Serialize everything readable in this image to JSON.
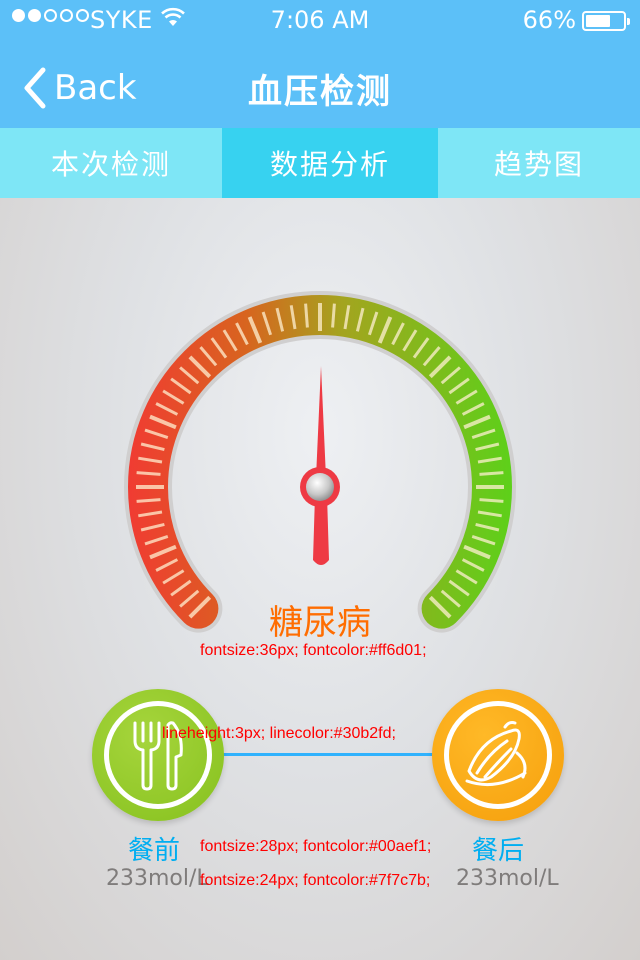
{
  "status_bar": {
    "carrier": "SYKE",
    "time": "7:06 AM",
    "battery": "66%",
    "signal_bars": 2,
    "battery_level": 0.66
  },
  "nav": {
    "back_label": "Back",
    "title": "血压检测"
  },
  "tabs": [
    {
      "label": "本次检测",
      "active": false
    },
    {
      "label": "数据分析",
      "active": true
    },
    {
      "label": "趋势图",
      "active": false
    }
  ],
  "gauge": {
    "state_label": "糖尿病",
    "state_color": "#ff6d01",
    "needle_value": 0.5,
    "gradient_colors": [
      "#f03c32",
      "#d8641f",
      "#a4a41f",
      "#5cd11a"
    ],
    "needle_color": "#ee3a44"
  },
  "meals": {
    "before": {
      "label": "餐前",
      "value": "233mol/L",
      "icon": "fork-knife-icon"
    },
    "after": {
      "label": "餐后",
      "value": "233mol/L",
      "icon": "food-icon"
    },
    "label_color": "#00aef1",
    "value_color": "#7f7c7b",
    "line_color": "#30b2fd"
  },
  "annotations": {
    "state": "fontsize:36px; fontcolor:#ff6d01;",
    "line": "lineheight:3px;  linecolor:#30b2fd;",
    "meal_label": "fontsize:28px; fontcolor:#00aef1;",
    "meal_value": "fontsize:24px; fontcolor:#7f7c7b;"
  }
}
